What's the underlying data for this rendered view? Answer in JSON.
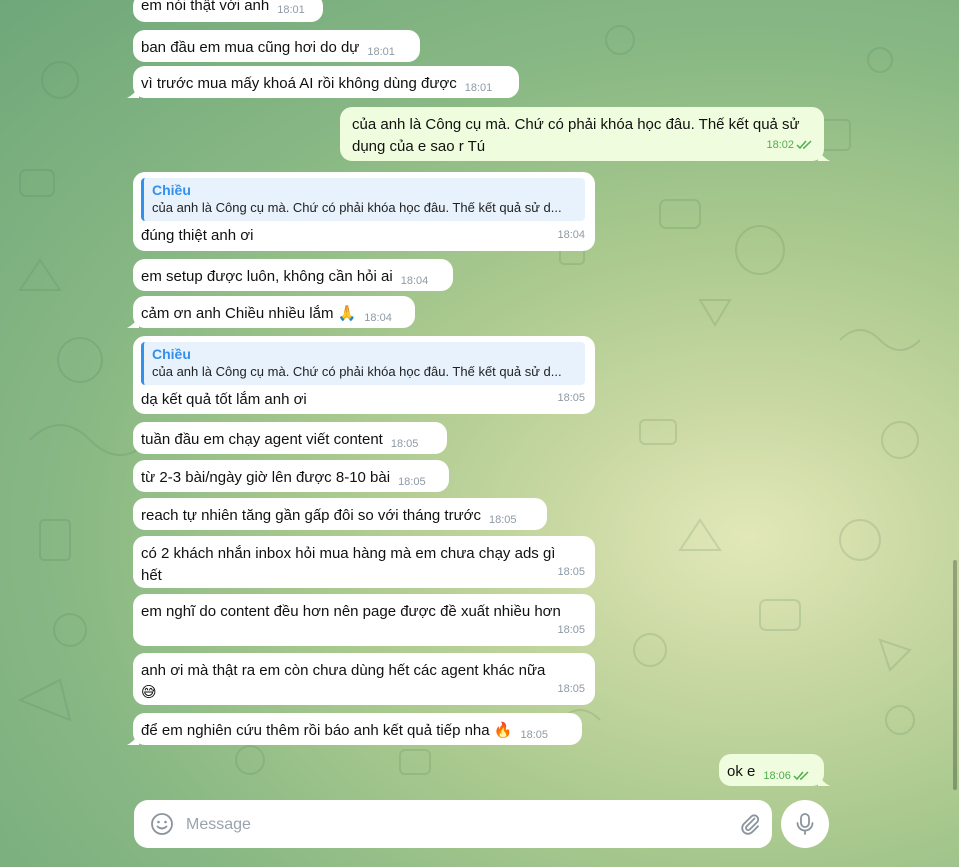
{
  "messages": [
    {
      "dir": "in",
      "text": "em nói thật với anh",
      "time": "18:01"
    },
    {
      "dir": "in",
      "text": "ban đầu em mua cũng hơi do dự",
      "time": "18:01"
    },
    {
      "dir": "in",
      "text": "vì trước mua mấy khoá AI rồi không dùng được",
      "time": "18:01"
    },
    {
      "dir": "out",
      "text": "của anh là Công cụ mà. Chứ có phải khóa học đâu. Thế kết quả sử dụng của e sao r Tú",
      "time": "18:02"
    },
    {
      "dir": "in",
      "reply_name": "Chiều",
      "reply_text": "của anh là Công cụ mà. Chứ có phải khóa học đâu. Thế kết quả sử d...",
      "text": "đúng thiệt anh ơi",
      "time": "18:04"
    },
    {
      "dir": "in",
      "text": "em setup được luôn, không cần hỏi ai",
      "time": "18:04"
    },
    {
      "dir": "in",
      "text": "cảm ơn anh Chiều nhiều lắm 🙏",
      "time": "18:04"
    },
    {
      "dir": "in",
      "reply_name": "Chiều",
      "reply_text": "của anh là Công cụ mà. Chứ có phải khóa học đâu. Thế kết quả sử d...",
      "text": "dạ kết quả tốt lắm anh ơi",
      "time": "18:05"
    },
    {
      "dir": "in",
      "text": "tuần đầu em chạy agent viết content",
      "time": "18:05"
    },
    {
      "dir": "in",
      "text": "từ 2-3 bài/ngày giờ lên được 8-10 bài",
      "time": "18:05"
    },
    {
      "dir": "in",
      "text": "reach tự nhiên tăng gần gấp đôi so với tháng trước",
      "time": "18:05"
    },
    {
      "dir": "in",
      "text": "có 2 khách nhắn inbox hỏi mua hàng mà em chưa chạy ads gì hết",
      "time": "18:05"
    },
    {
      "dir": "in",
      "text": "em nghĩ do content đều hơn nên page được đề xuất nhiều hơn",
      "time": "18:05"
    },
    {
      "dir": "in",
      "text": "anh ơi mà thật ra em còn chưa dùng hết các agent khác nữa 😅",
      "time": "18:05"
    },
    {
      "dir": "in",
      "text": "để em nghiên cứu thêm rồi báo anh kết quả tiếp nha 🔥",
      "time": "18:05"
    },
    {
      "dir": "out",
      "text": "ok e",
      "time": "18:06"
    }
  ],
  "composer": {
    "placeholder": "Message",
    "value": ""
  },
  "icons": {
    "emoji": "smile-icon",
    "attach": "paperclip-icon",
    "mic": "microphone-icon",
    "read": "double-check-icon"
  },
  "colors": {
    "incoming": "#ffffff",
    "outgoing": "#effdde",
    "accent": "#3390ec",
    "read_check": "#4fae4e",
    "time": "#8e9aa5"
  }
}
